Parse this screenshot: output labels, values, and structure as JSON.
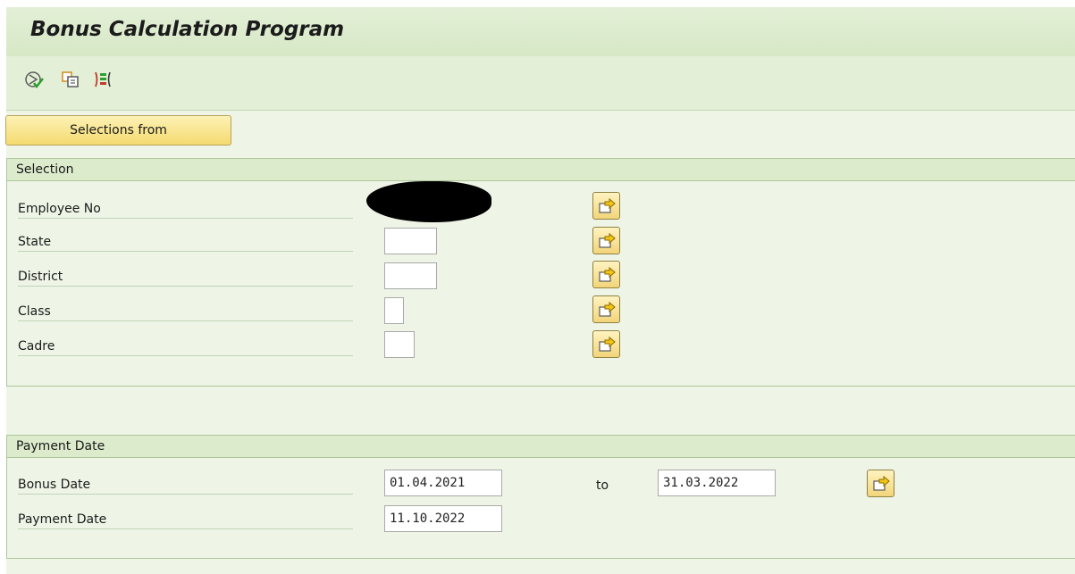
{
  "title": "Bonus Calculation Program",
  "toolbar": {
    "icons": [
      "execute-icon",
      "get-variant-icon",
      "selection-options-icon"
    ]
  },
  "selections_button": "Selections from",
  "selection_block": {
    "header": "Selection",
    "fields": [
      {
        "label": "Employee No",
        "value": ""
      },
      {
        "label": "State",
        "value": ""
      },
      {
        "label": "District",
        "value": ""
      },
      {
        "label": "Class",
        "value": ""
      },
      {
        "label": "Cadre",
        "value": ""
      }
    ]
  },
  "payment_block": {
    "header": "Payment Date",
    "bonus_date": {
      "label": "Bonus Date",
      "from": "01.04.2021",
      "to_label": "to",
      "to": "31.03.2022"
    },
    "payment_date": {
      "label": "Payment Date",
      "value": "11.10.2022"
    }
  },
  "colors": {
    "background": "#eef5e6",
    "title_bar": "#dcebcc",
    "button_yellow": "#f4da6f",
    "arrow_yellow": "#f5c518"
  }
}
